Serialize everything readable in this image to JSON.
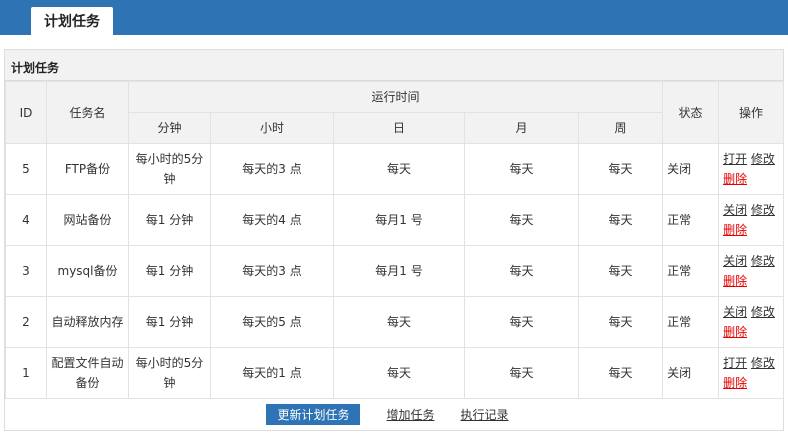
{
  "header": {
    "tab_title": "计划任务"
  },
  "panel": {
    "title": "计划任务"
  },
  "table": {
    "headers": {
      "id": "ID",
      "name": "任务名",
      "run_time": "运行时间",
      "minute": "分钟",
      "hour": "小时",
      "day": "日",
      "month": "月",
      "week": "周",
      "status": "状态",
      "action": "操作"
    },
    "rows": [
      {
        "id": "5",
        "name": "FTP备份",
        "minute": "每小时的5分钟",
        "hour": "每天的3 点",
        "day": "每天",
        "month": "每天",
        "week": "每天",
        "status": "关闭",
        "toggle": "打开",
        "edit": "修改",
        "delete": "删除"
      },
      {
        "id": "4",
        "name": "网站备份",
        "minute": "每1 分钟",
        "hour": "每天的4 点",
        "day": "每月1 号",
        "month": "每天",
        "week": "每天",
        "status": "正常",
        "toggle": "关闭",
        "edit": "修改",
        "delete": "删除"
      },
      {
        "id": "3",
        "name": "mysql备份",
        "minute": "每1 分钟",
        "hour": "每天的3 点",
        "day": "每月1 号",
        "month": "每天",
        "week": "每天",
        "status": "正常",
        "toggle": "关闭",
        "edit": "修改",
        "delete": "删除"
      },
      {
        "id": "2",
        "name": "自动释放内存",
        "minute": "每1 分钟",
        "hour": "每天的5 点",
        "day": "每天",
        "month": "每天",
        "week": "每天",
        "status": "正常",
        "toggle": "关闭",
        "edit": "修改",
        "delete": "删除"
      },
      {
        "id": "1",
        "name": "配置文件自动备份",
        "minute": "每小时的5分钟",
        "hour": "每天的1 点",
        "day": "每天",
        "month": "每天",
        "week": "每天",
        "status": "关闭",
        "toggle": "打开",
        "edit": "修改",
        "delete": "删除"
      }
    ]
  },
  "footer": {
    "update_button": "更新计划任务",
    "add_link": "增加任务",
    "log_link": "执行记录"
  }
}
